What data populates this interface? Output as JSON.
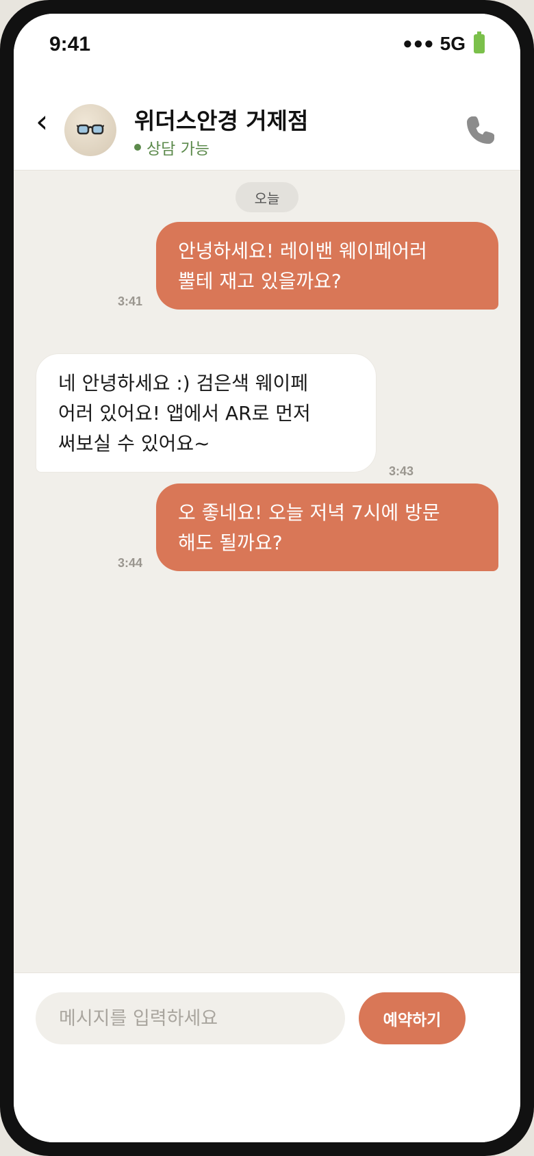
{
  "status_bar": {
    "time": "9:41",
    "signal": "●●●",
    "network": "5G"
  },
  "header": {
    "back_symbol": "‹",
    "store_name": "위더스안경 거제점",
    "status": "상담 가능",
    "avatar_icon": "glasses-icon",
    "call_icon": "phone-icon"
  },
  "chat": {
    "date_label": "오늘",
    "messages": [
      {
        "direction": "out",
        "lines": [
          "안녕하세요! 레이밴 웨이페어러",
          "뿔테 재고 있을까요?"
        ],
        "time": "3:41"
      },
      {
        "direction": "in",
        "lines": [
          "네 안녕하세요 :) 검은색 웨이페",
          "어러 있어요! 앱에서 AR로 먼저",
          "써보실 수 있어요~"
        ],
        "time": "3:43"
      },
      {
        "direction": "out",
        "lines": [
          "오 좋네요! 오늘 저녁 7시에 방문",
          "해도 될까요?"
        ],
        "time": "3:44"
      }
    ]
  },
  "input_bar": {
    "placeholder": "메시지를 입력하세요",
    "value": "",
    "book_label": "예약하기"
  },
  "colors": {
    "accent": "#d97757",
    "online": "#5c8a4c",
    "background": "#f1efea"
  }
}
